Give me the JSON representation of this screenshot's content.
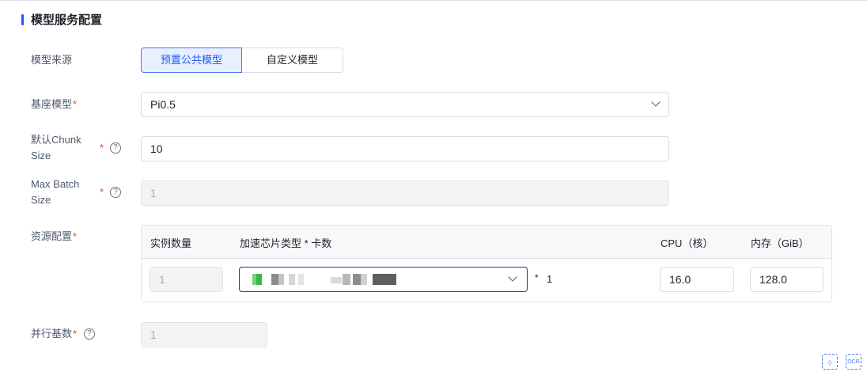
{
  "section": {
    "title": "模型服务配置"
  },
  "model_source": {
    "label": "模型来源",
    "options": [
      "预置公共模型",
      "自定义模型"
    ],
    "selected": "预置公共模型"
  },
  "base_model": {
    "label": "基座模型",
    "required": "*",
    "value": "Pi0.5"
  },
  "chunk_size": {
    "label_line1": "默认Chunk",
    "label_line2": "Size",
    "required": "*",
    "value": "10"
  },
  "max_batch": {
    "label_line1": "Max Batch",
    "label_line2": "Size",
    "required": "*",
    "value": "1"
  },
  "resource": {
    "label": "资源配置",
    "required": "*",
    "headers": [
      "实例数量",
      "加速芯片类型 * 卡数",
      "CPU（核）",
      "内存（GiB）"
    ],
    "instances": "1",
    "multiplier": "*",
    "card_count": "1",
    "cpu": "16.0",
    "memory": "128.0"
  },
  "parallel": {
    "label": "并行基数",
    "required": "*",
    "value": "1"
  },
  "help_glyph": "?",
  "bottom_icons": [
    "expand-icon",
    "ocr-icon"
  ],
  "bottom_icon_labels": [
    "⊹",
    "OCR"
  ],
  "colors": {
    "primary": "#1f5bf5",
    "required": "#f53f3f",
    "border": "#d9dce1"
  }
}
